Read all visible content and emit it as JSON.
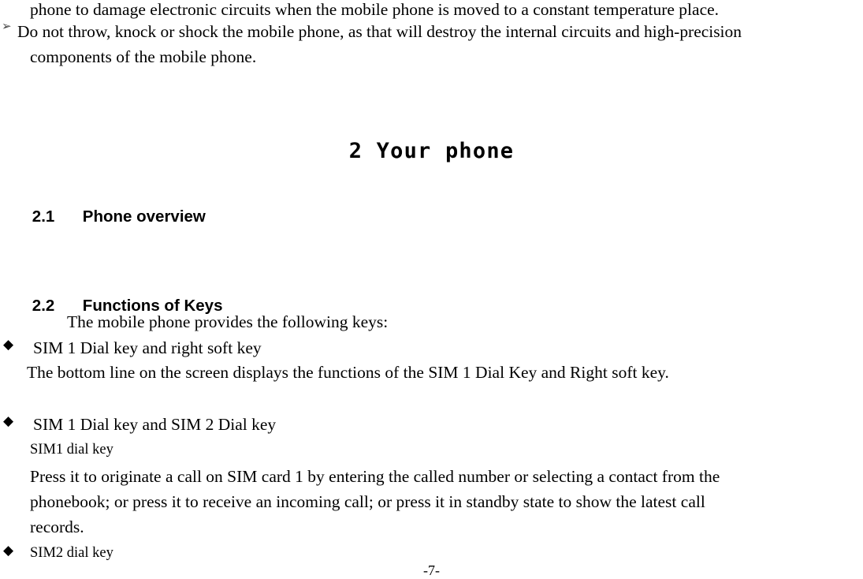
{
  "document": {
    "page_number_label": "-7-"
  },
  "intro": {
    "continued_line": "phone to damage electronic circuits when the mobile phone is moved to a constant temperature place.",
    "arrow_bullet_icon": "➢",
    "warning_line_1": "Do not throw, knock or shock the mobile phone, as that will destroy the internal circuits and high-precision",
    "warning_line_2": "components of the mobile phone."
  },
  "chapter": {
    "heading": "2   Your  phone"
  },
  "sections": {
    "phone_overview": {
      "number": "2.1",
      "title": "Phone overview"
    },
    "functions_of_keys": {
      "number": "2.2",
      "title": "Functions of Keys",
      "lead_in": "The mobile phone provides the following keys:",
      "bullet_icon": "◆",
      "items": [
        {
          "heading": "SIM 1 Dial key and right soft key",
          "description": "The bottom line on the screen displays the functions of the SIM 1 Dial Key and Right soft key."
        },
        {
          "heading": "SIM 1 Dial key and SIM 2 Dial key",
          "sub_label": "SIM1 dial key",
          "description_lines": [
            "Press it to originate a call on SIM card 1 by entering the called number or selecting a contact from the",
            "phonebook; or press it to receive an incoming call; or press it in standby state to show the latest call",
            "records."
          ]
        },
        {
          "heading": "SIM2 dial key"
        }
      ]
    }
  }
}
